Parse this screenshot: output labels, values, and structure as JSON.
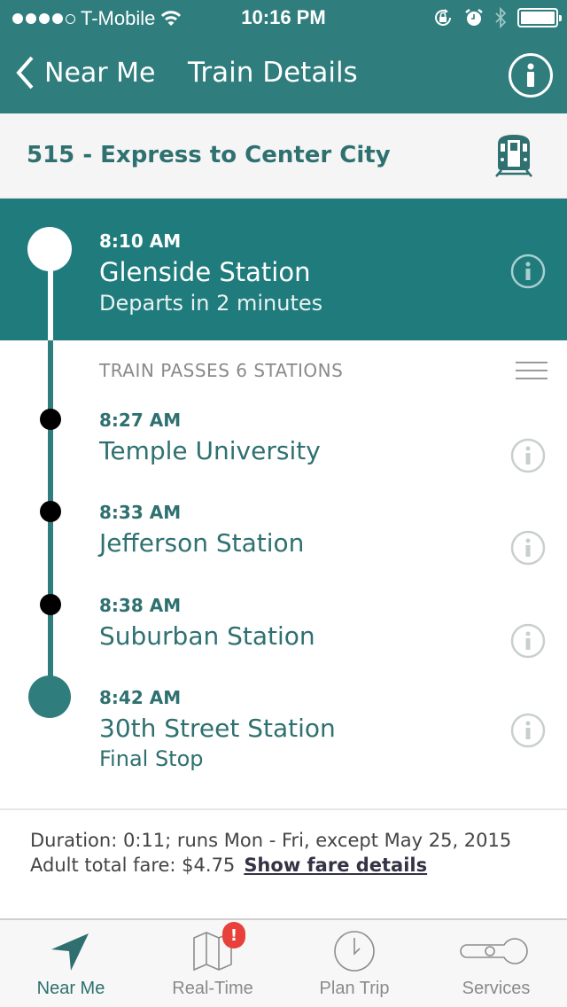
{
  "status_bar": {
    "signal_bars_filled": 4,
    "signal_bars_total": 5,
    "carrier": "T-Mobile",
    "time": "10:16 PM",
    "icons": [
      "wifi-icon",
      "rotation-lock-icon",
      "alarm-icon",
      "bluetooth-icon",
      "battery-icon"
    ]
  },
  "nav": {
    "back_label": "Near Me",
    "title": "Train Details",
    "info_icon": "info-icon"
  },
  "route": {
    "title": "515 - Express to Center City",
    "icon": "train-icon"
  },
  "origin": {
    "time": "8:10 AM",
    "name": "Glenside Station",
    "subtitle": "Departs in 2 minutes"
  },
  "passes_label": "TRAIN PASSES 6 STATIONS",
  "stops": [
    {
      "time": "8:27 AM",
      "name": "Temple University",
      "subtitle": ""
    },
    {
      "time": "8:33 AM",
      "name": "Jefferson Station",
      "subtitle": ""
    },
    {
      "time": "8:38 AM",
      "name": "Suburban Station",
      "subtitle": ""
    },
    {
      "time": "8:42 AM",
      "name": "30th Street Station",
      "subtitle": "Final Stop"
    }
  ],
  "trip_info": {
    "duration_line": "Duration: 0:11; runs Mon - Fri, except May 25, 2015",
    "fare_line": "Adult total fare: $4.75",
    "fare_link": "Show fare details"
  },
  "tabs": [
    {
      "label": "Near Me",
      "icon": "location-arrow-icon",
      "active": true
    },
    {
      "label": "Real-Time",
      "icon": "map-icon",
      "badge": "!"
    },
    {
      "label": "Plan Trip",
      "icon": "clock-icon"
    },
    {
      "label": "Services",
      "icon": "key-icon"
    }
  ],
  "colors": {
    "header_teal": "#2f7d7d",
    "origin_teal": "#207c7c",
    "text_teal": "#2f7070",
    "badge_red": "#e8403a"
  }
}
